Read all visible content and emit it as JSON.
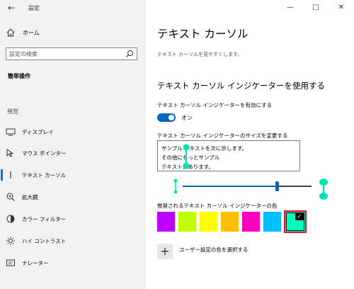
{
  "window": {
    "title": "設定"
  },
  "sidebar": {
    "home": "ホーム",
    "search_placeholder": "設定の検索",
    "section_title": "簡単操作",
    "group_label": "視覚",
    "items": [
      {
        "label": "ディスプレイ",
        "icon": "display-icon"
      },
      {
        "label": "マウス ポインター",
        "icon": "mouse-pointer-icon"
      },
      {
        "label": "テキスト カーソル",
        "icon": "text-cursor-icon",
        "active": true
      },
      {
        "label": "拡大鏡",
        "icon": "magnifier-icon"
      },
      {
        "label": "カラー フィルター",
        "icon": "color-filter-icon"
      },
      {
        "label": "ハイ コントラスト",
        "icon": "high-contrast-icon"
      },
      {
        "label": "ナレーター",
        "icon": "narrator-icon"
      }
    ]
  },
  "main": {
    "title": "テキスト カーソル",
    "description": "テキスト カーソルを見やすくします。",
    "section_heading": "テキスト カーソル インジケーターを使用する",
    "toggle_label": "テキスト カーソル インジケーターを有効にする",
    "toggle_state": "オン",
    "size_label": "テキスト カーソル インジケーターのサイズを変更する",
    "preview_lines": [
      "サンプル テキストを次に示します。",
      "その他にもっとサンプル",
      "テキストがあります。"
    ],
    "slider_value": 0.8,
    "colors_label": "推奨されるテキスト カーソル インジケーターの色",
    "swatches": [
      "#bf00ff",
      "#bfff00",
      "#ffff00",
      "#ffbf00",
      "#ff00bf",
      "#00bfff",
      "#00ffbf"
    ],
    "selected_swatch": 6,
    "custom_color_label": "ユーザー設定の色を選択する"
  },
  "colors": {
    "accent": "#0067c0",
    "indicator": "#00e5b0",
    "selected_border": "#e81123"
  }
}
